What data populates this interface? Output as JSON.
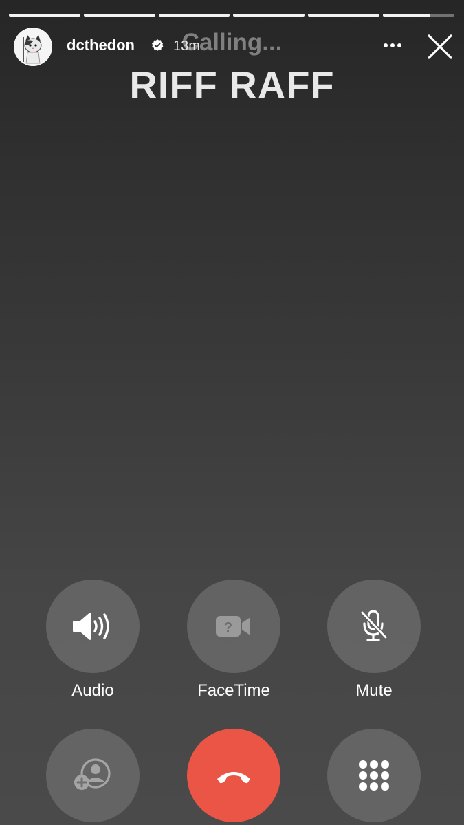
{
  "story": {
    "progress_segments": [
      1,
      1,
      1,
      1,
      1,
      0.65
    ],
    "username": "dcthedon",
    "verified": true,
    "timestamp": "13m",
    "more_icon": "more-horizontal-icon",
    "close_icon": "close-icon"
  },
  "call": {
    "status": "Calling...",
    "contact_name": "RIFF RAFF",
    "buttons": [
      {
        "label": "Audio",
        "icon": "speaker-icon"
      },
      {
        "label": "FaceTime",
        "icon": "facetime-icon"
      },
      {
        "label": "Mute",
        "icon": "mute-mic-icon"
      },
      {
        "label": "",
        "icon": "add-contact-icon"
      },
      {
        "label": "",
        "icon": "end-call-icon",
        "color": "#eb5545"
      },
      {
        "label": "",
        "icon": "keypad-icon"
      }
    ]
  }
}
